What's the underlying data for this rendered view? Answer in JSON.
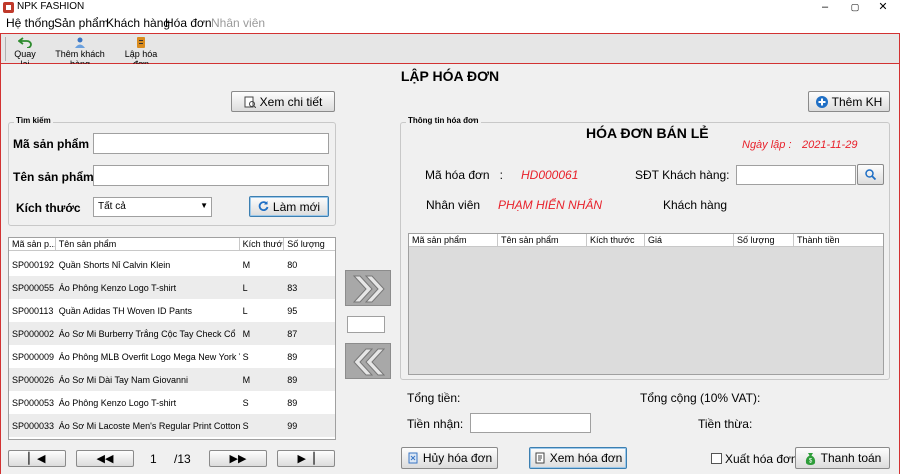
{
  "window": {
    "title": "NPK FASHION",
    "minimize": "–",
    "maximize": "▢",
    "close": "✕"
  },
  "menu": [
    "Hệ thống",
    "Sản phẩm",
    "Khách hàng",
    "Hóa đơn",
    "Nhân viên"
  ],
  "toolbar": {
    "back": "Quay lại",
    "add_customer": "Thêm khách hàng",
    "create_invoice": "Lập hóa đơn"
  },
  "page_title": "LẬP HÓA ĐƠN",
  "buttons": {
    "view_detail": "Xem chi tiết",
    "add_customer": "Thêm KH",
    "refresh": "Làm mới",
    "cancel_invoice": "Hủy hóa đơn",
    "view_invoice": "Xem hóa đơn",
    "export_invoice": "Xuất hóa đơn",
    "pay": "Thanh toán"
  },
  "search": {
    "legend": "Tìm kiếm",
    "code_label": "Mã sản phẩm",
    "name_label": "Tên sản phẩm",
    "size_label": "Kích thước",
    "size_selected": "Tất cả"
  },
  "products": {
    "columns": [
      "Mã sản p...",
      "Tên sản phẩm",
      "Kích thước",
      "Số lượng"
    ],
    "rows": [
      [
        "SP000192",
        "Quần Shorts Nỉ Calvin Klein",
        "M",
        "80"
      ],
      [
        "SP000055",
        "Áo Phông Kenzo Logo T-shirt",
        "L",
        "83"
      ],
      [
        "SP000113",
        "Quần Adidas TH Woven ID Pants",
        "L",
        "95"
      ],
      [
        "SP000002",
        "Áo Sơ Mi Burberry Trắng Cộc Tay Check Cổ",
        "M",
        "87"
      ],
      [
        "SP000009",
        "Áo Phông MLB Overfit Logo Mega New York Yan...",
        "S",
        "89"
      ],
      [
        "SP000026",
        "Áo Sơ Mi Dài Tay Nam Giovanni",
        "M",
        "89"
      ],
      [
        "SP000053",
        "Áo Phông Kenzo Logo T-shirt",
        "S",
        "89"
      ],
      [
        "SP000033",
        "Áo Sơ Mi Lacoste Men's Regular Print Cotton Po...",
        "S",
        "99"
      ]
    ]
  },
  "paging": {
    "current": "1",
    "total": "/13"
  },
  "invoice": {
    "legend": "Thông tin hóa đơn",
    "heading": "HÓA ĐƠN BÁN LẺ",
    "date_label": "Ngày lập :",
    "date_value": "2021-11-29",
    "id_label": "Mã hóa đơn   :",
    "id_value": "HD000061",
    "phone_label": "SĐT Khách hàng:",
    "staff_label": "Nhân viên",
    "staff_value": "PHẠM HIỂN NHÂN",
    "customer_label": "Khách hàng",
    "columns": [
      "Mã sản phẩm",
      "Tên sản phẩm",
      "Kích thước",
      "Giá",
      "Số lượng",
      "Thành tiền"
    ]
  },
  "totals": {
    "subtotal_label": "Tổng tiền:",
    "total_label": "Tổng cộng (10% VAT):",
    "received_label": "Tiền nhận:",
    "change_label": "Tiền thừa:"
  },
  "colors": {
    "accent_red": "#d23232",
    "highlight_red": "#e8202a",
    "border_red": "#d23232"
  }
}
